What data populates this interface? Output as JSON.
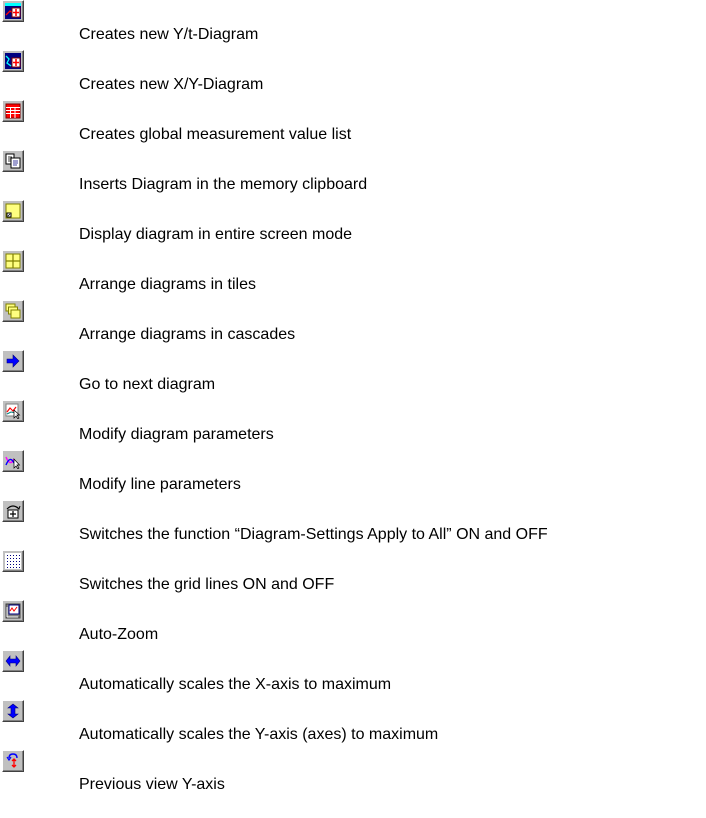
{
  "toolbar_reference": {
    "items": [
      {
        "icon": "new-yt-diagram-icon",
        "label": "Creates new Y/t-Diagram"
      },
      {
        "icon": "new-xy-diagram-icon",
        "label": "Creates new X/Y-Diagram"
      },
      {
        "icon": "measurement-list-icon",
        "label": "Creates global measurement value list"
      },
      {
        "icon": "clipboard-copy-icon",
        "label": "Inserts Diagram in the memory clipboard"
      },
      {
        "icon": "fullscreen-icon",
        "label": "Display diagram in entire screen mode"
      },
      {
        "icon": "tile-icon",
        "label": "Arrange diagrams in tiles"
      },
      {
        "icon": "cascade-icon",
        "label": "Arrange diagrams in cascades"
      },
      {
        "icon": "next-arrow-icon",
        "label": "Go to next diagram"
      },
      {
        "icon": "diagram-params-icon",
        "label": "Modify diagram parameters"
      },
      {
        "icon": "line-params-icon",
        "label": "Modify line parameters"
      },
      {
        "icon": "apply-all-icon",
        "label": "Switches the function “Diagram-Settings Apply to All” ON and OFF"
      },
      {
        "icon": "grid-icon",
        "label": "Switches the grid lines ON and OFF"
      },
      {
        "icon": "auto-zoom-icon",
        "label": "Auto-Zoom"
      },
      {
        "icon": "scale-x-icon",
        "label": "Automatically scales the X-axis to maximum"
      },
      {
        "icon": "scale-y-icon",
        "label": "Automatically scales the Y-axis (axes) to maximum"
      },
      {
        "icon": "previous-view-y-icon",
        "label": "Previous view Y-axis"
      }
    ]
  }
}
